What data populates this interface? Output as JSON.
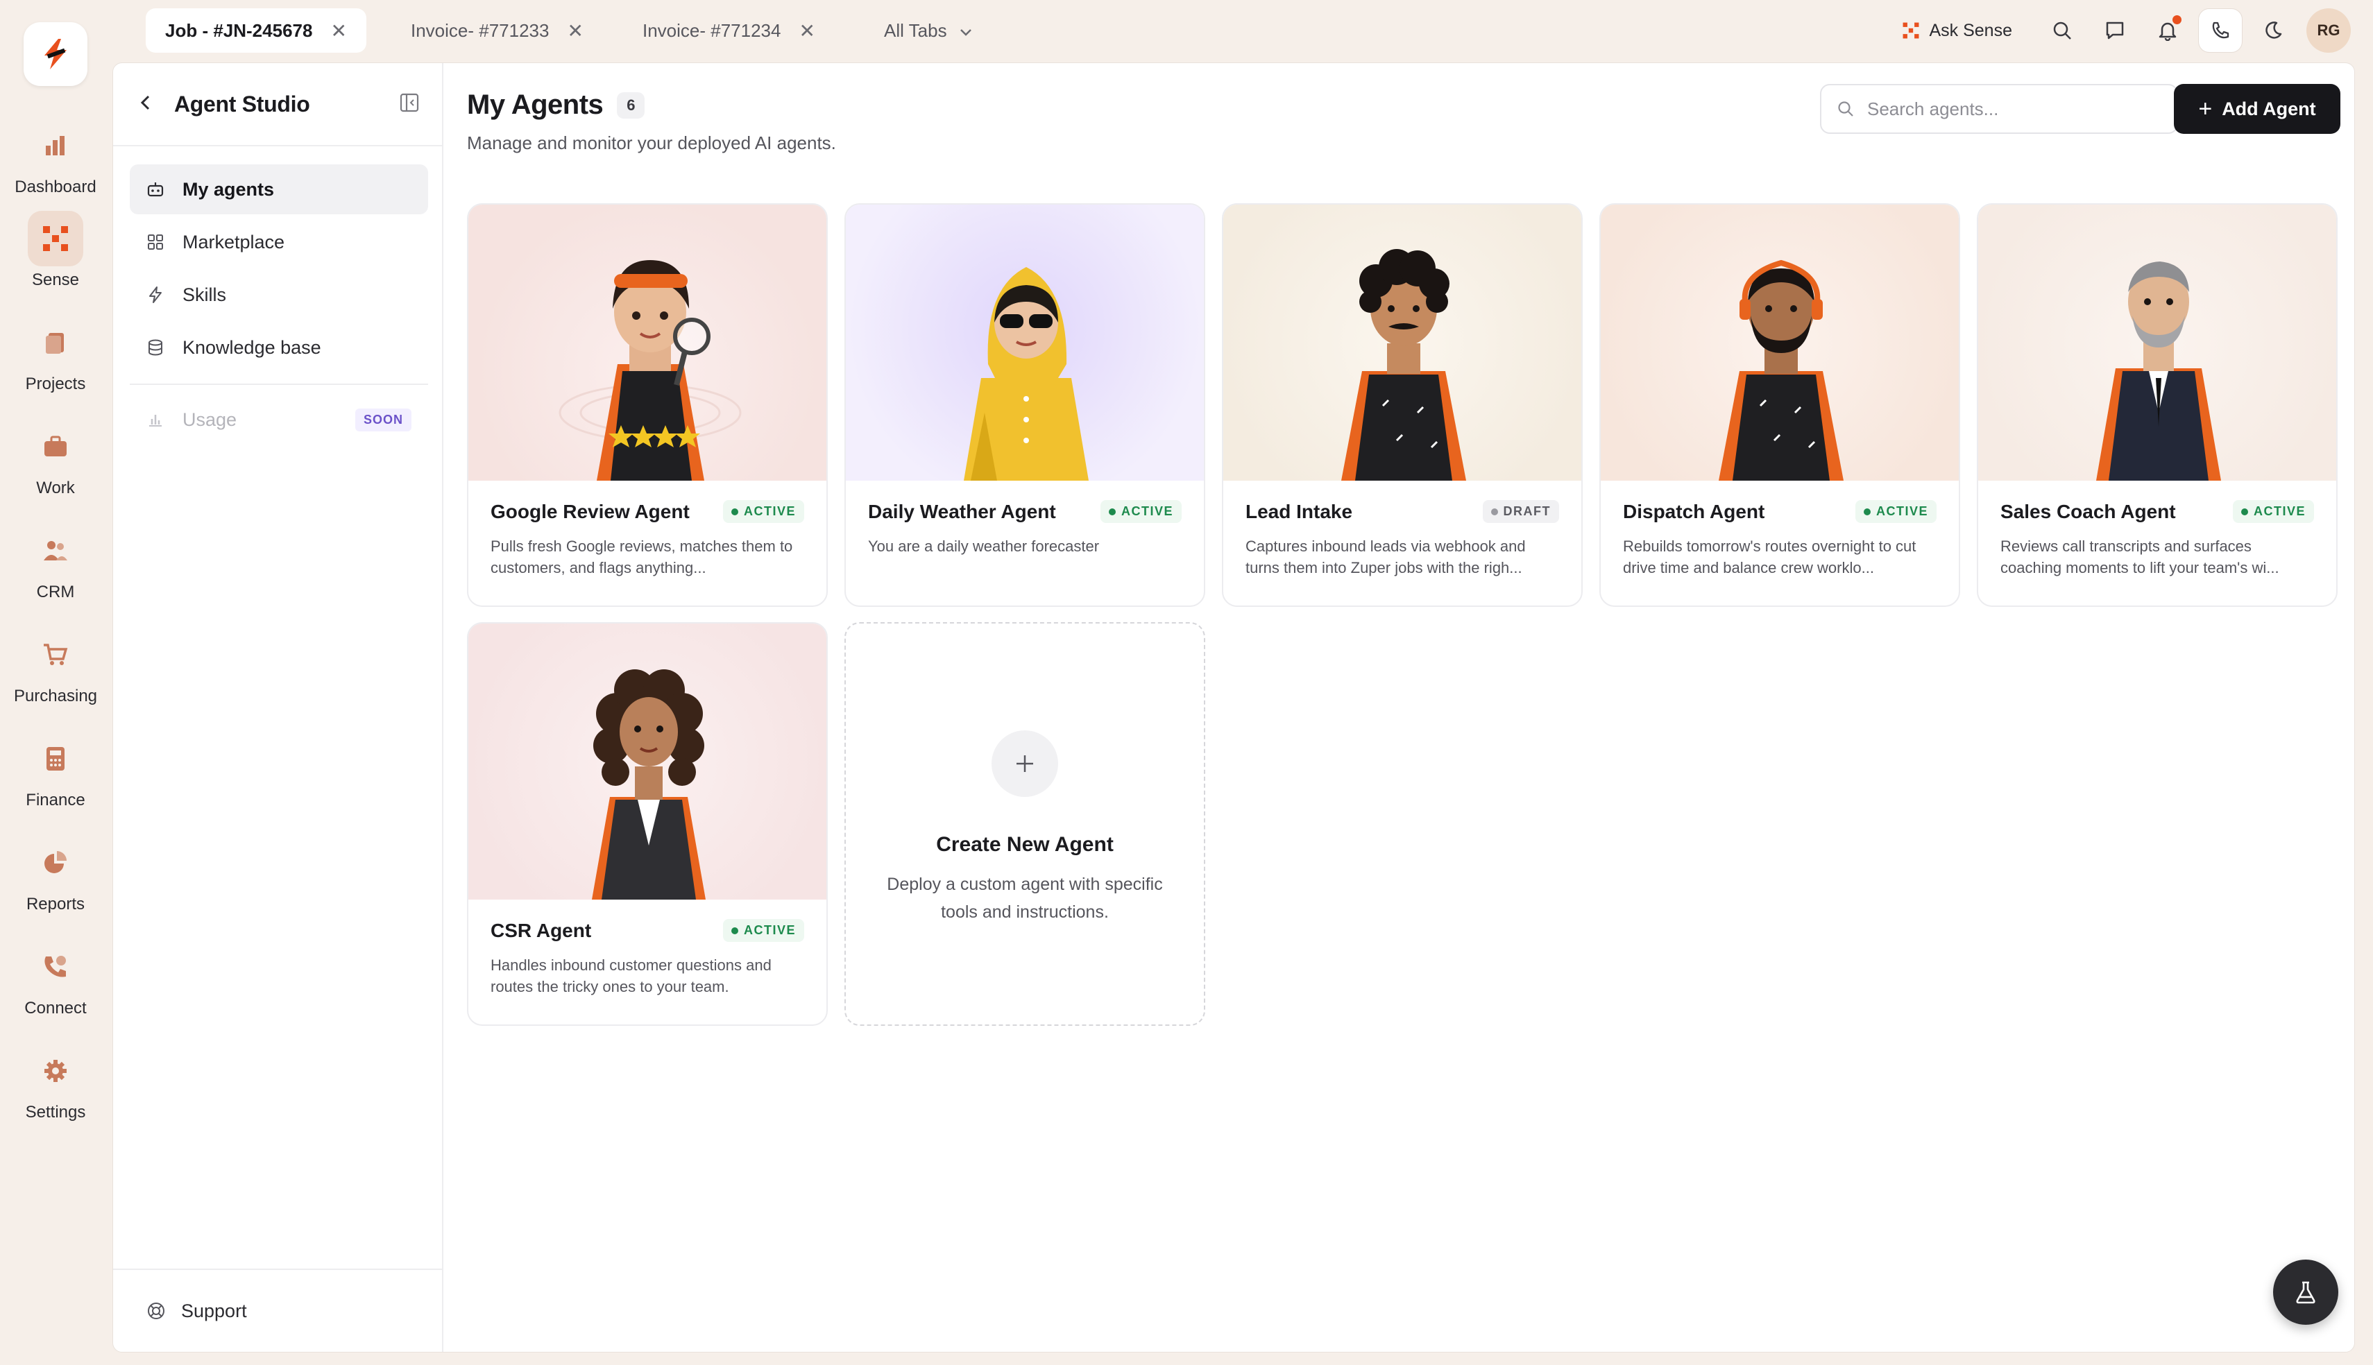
{
  "rail": {
    "items": [
      {
        "label": "Dashboard",
        "icon": "bar-chart-icon"
      },
      {
        "label": "Sense",
        "icon": "sense-grid-icon"
      },
      {
        "label": "Projects",
        "icon": "projects-icon"
      },
      {
        "label": "Work",
        "icon": "briefcase-icon"
      },
      {
        "label": "CRM",
        "icon": "users-icon"
      },
      {
        "label": "Purchasing",
        "icon": "cart-icon"
      },
      {
        "label": "Finance",
        "icon": "calculator-icon"
      },
      {
        "label": "Reports",
        "icon": "pie-chart-icon"
      },
      {
        "label": "Connect",
        "icon": "phone-icon"
      },
      {
        "label": "Settings",
        "icon": "gear-icon"
      }
    ]
  },
  "tabs": [
    {
      "label": "Job - #JN-245678"
    },
    {
      "label": "Invoice- #771233"
    },
    {
      "label": "Invoice- #771234"
    },
    {
      "label": "All Tabs"
    }
  ],
  "topbar": {
    "ask_sense": "Ask Sense",
    "avatar_initials": "RG"
  },
  "sidebar": {
    "title": "Agent Studio",
    "items": [
      {
        "label": "My agents"
      },
      {
        "label": "Marketplace"
      },
      {
        "label": "Skills"
      },
      {
        "label": "Knowledge base"
      },
      {
        "label": "Usage",
        "badge": "SOON"
      }
    ],
    "support": "Support"
  },
  "main": {
    "title": "My Agents",
    "count": "6",
    "subtitle": "Manage and monitor your deployed AI agents.",
    "search_placeholder": "Search agents...",
    "add_button": "Add Agent"
  },
  "agents": [
    {
      "name": "Google Review Agent",
      "status": "ACTIVE",
      "description": "Pulls fresh Google reviews, matches them to customers, and flags anything...",
      "bg": "#f6e5e2"
    },
    {
      "name": "Daily Weather Agent",
      "status": "ACTIVE",
      "description": "You are a daily weather forecaster",
      "bg": "#ece6fb"
    },
    {
      "name": "Lead Intake",
      "status": "DRAFT",
      "description": "Captures inbound leads via webhook and turns them into Zuper jobs with the righ...",
      "bg": "#f6efe4"
    },
    {
      "name": "Dispatch Agent",
      "status": "ACTIVE",
      "description": "Rebuilds tomorrow's routes overnight to cut drive time and balance crew worklo...",
      "bg": "#f8ebe4"
    },
    {
      "name": "Sales Coach Agent",
      "status": "ACTIVE",
      "description": "Reviews call transcripts and surfaces coaching moments to lift your team's wi...",
      "bg": "#f7eee8"
    },
    {
      "name": "CSR Agent",
      "status": "ACTIVE",
      "description": "Handles inbound customer questions and routes the tricky ones to your team.",
      "bg": "#f7e6e6"
    }
  ],
  "create": {
    "title": "Create New Agent",
    "description": "Deploy a custom agent with specific tools and instructions."
  },
  "colors": {
    "accent": "#e8501e",
    "active": "#1d8a4d",
    "dark": "#17171b"
  }
}
